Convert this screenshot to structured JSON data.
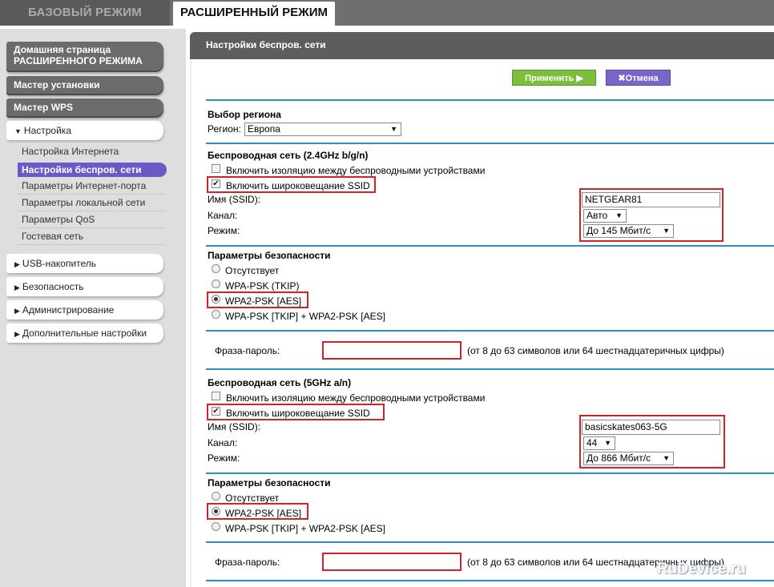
{
  "tabs": {
    "basic": "БАЗОВЫЙ РЕЖИМ",
    "advanced": "РАСШИРЕННЫЙ РЕЖИМ"
  },
  "sidebar": {
    "home_line1": "Домашняя страница",
    "home_line2": "РАСШИРЕННОГО РЕЖИМА",
    "setup_wizard": "Мастер установки",
    "wps_wizard": "Мастер WPS",
    "setup": "Настройка",
    "sub_items": [
      "Настройка Интернета",
      "Настройки беспров. сети",
      "Параметры Интернет-порта",
      "Параметры локальной сети",
      "Параметры QoS",
      "Гостевая сеть"
    ],
    "usb": "USB-накопитель",
    "security": "Безопасность",
    "admin": "Администрирование",
    "advanced": "Дополнительные настройки"
  },
  "main": {
    "title": "Настройки беспров. сети",
    "apply": "Применить",
    "cancel": "Отмена",
    "region_title": "Выбор региона",
    "region_label": "Регион:",
    "region_value": "Европа",
    "wifi24": {
      "title": "Беспроводная сеть (2.4GHz b/g/n)",
      "isolation": "Включить изоляцию между беспроводными устройствами",
      "broadcast": "Включить широковещание SSID",
      "ssid_label": "Имя (SSID):",
      "ssid_value": "NETGEAR81",
      "channel_label": "Канал:",
      "channel_value": "Авто",
      "mode_label": "Режим:",
      "mode_value": "До 145 Мбит/с",
      "sec_title": "Параметры безопасности",
      "sec_none": "Отсутствует",
      "sec_tkip": "WPA-PSK (TKIP)",
      "sec_aes": "WPA2-PSK [AES]",
      "sec_mixed": "WPA-PSK [TKIP] + WPA2-PSK [AES]",
      "pass_label": "Фраза-пароль:",
      "pass_hint": "(от 8 до 63 символов или 64 шестнадцатеричных цифры)"
    },
    "wifi5": {
      "title": "Беспроводная сеть (5GHz a/n)",
      "isolation": "Включить изоляцию между беспроводными устройствами",
      "broadcast": "Включить широковещание SSID",
      "ssid_label": "Имя (SSID):",
      "ssid_value": "basicskates063-5G",
      "channel_label": "Канал:",
      "channel_value": "44",
      "mode_label": "Режим:",
      "mode_value": "До 866 Мбит/с",
      "sec_title": "Параметры безопасности",
      "sec_none": "Отсутствует",
      "sec_aes": "WPA2-PSK [AES]",
      "sec_mixed": "WPA-PSK [TKIP] + WPA2-PSK [AES]",
      "pass_label": "Фраза-пароль:",
      "pass_hint": "(от 8 до 63 символов или 64 шестнадцатеричных цифры)"
    }
  },
  "watermark": "RuDevice.ru",
  "colors": {
    "accent_purple": "#6a5ac8",
    "apply_green": "#7bbf3d",
    "highlight_red": "#d2232a",
    "divider_blue": "#2f8fb8"
  }
}
